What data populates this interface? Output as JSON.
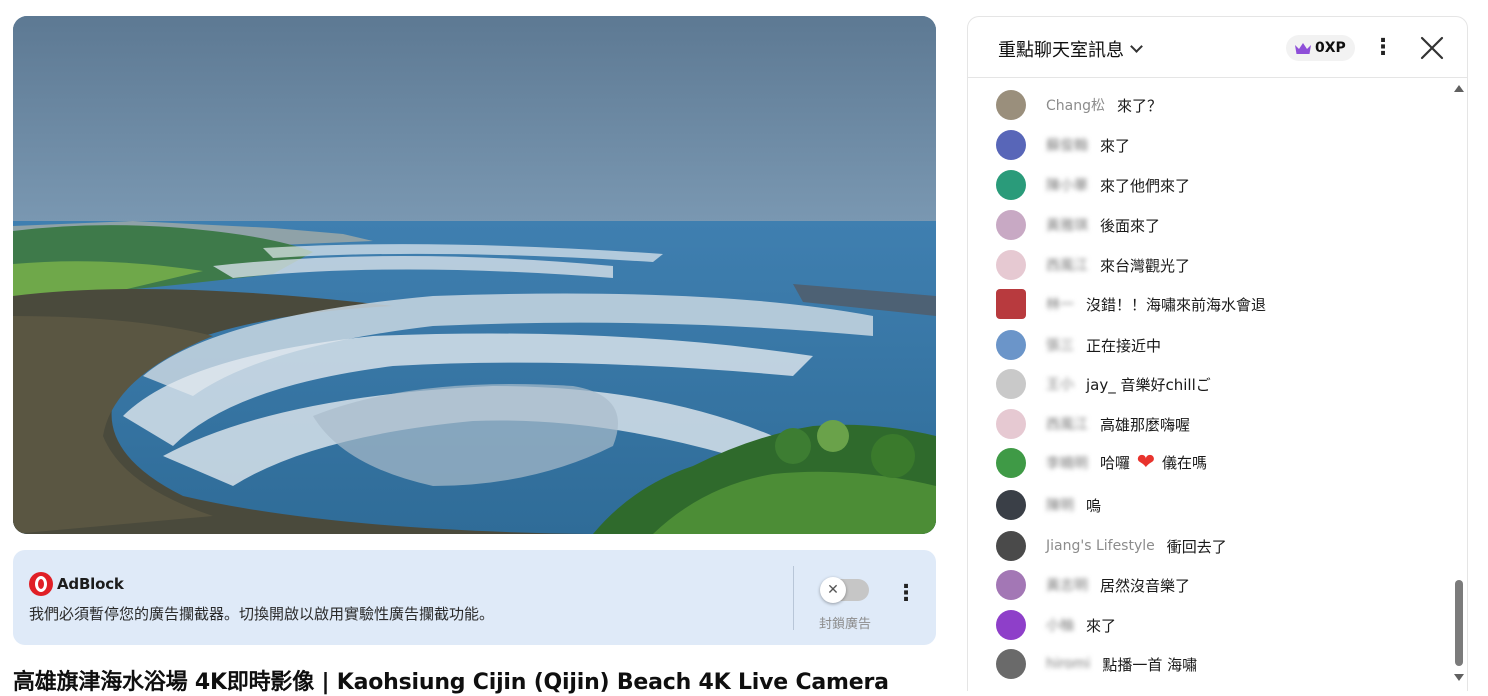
{
  "video": {
    "alt": "Kaohsiung Cijin beach live camera scene"
  },
  "adblock": {
    "brand": "AdBlock",
    "message": "我們必須暫停您的廣告攔截器。切換開啟以啟用實驗性廣告攔截功能。",
    "toggle_label": "封鎖廣告",
    "toggle_on": false
  },
  "title": "高雄旗津海水浴場 4K即時影像 | Kaohsiung Cijin (Qijin) Beach 4K Live Camera",
  "chat": {
    "mode_label": "重點聊天室訊息",
    "xp_label": "0XP",
    "messages": [
      {
        "author": "Chang松",
        "text": "來了？",
        "blurred": false,
        "avatar_color": "#9a8f7c"
      },
      {
        "author": "蘇俊翰",
        "text": "來了",
        "blurred": true,
        "avatar_color": "#5866b8"
      },
      {
        "author": "陳小華",
        "text": "來了他們來了",
        "blurred": true,
        "avatar_color": "#2a9b7a"
      },
      {
        "author": "黃雅琪",
        "text": "後面來了",
        "blurred": true,
        "avatar_color": "#c8a9c4"
      },
      {
        "author": "西風江",
        "text": "來台灣觀光了",
        "blurred": true,
        "avatar_color": "#e6c9d2"
      },
      {
        "author": "林一",
        "text": "沒錯！！海嘯來前海水會退",
        "blurred": true,
        "avatar_color": "#b83a3e"
      },
      {
        "author": "張三",
        "text": "正在接近中",
        "blurred": true,
        "avatar_color": "#6b95c9"
      },
      {
        "author": "王小",
        "text": "jay_ 音樂好chillご",
        "blurred": true,
        "avatar_color": "#c9c9c9"
      },
      {
        "author": "西風江",
        "text": "高雄那麼嗨喔",
        "blurred": true,
        "avatar_color": "#e6c9d2"
      },
      {
        "author": "李曉明",
        "text": "哈囉 ♥ 儀在嗎",
        "blurred": true,
        "avatar_color": "#3f9a46"
      },
      {
        "author": "陳明",
        "text": "嗚",
        "blurred": true,
        "avatar_color": "#3a3f47"
      },
      {
        "author": "Jiang's Lifestyle",
        "text": "衝回去了",
        "blurred": false,
        "avatar_color": "#4a4a4a"
      },
      {
        "author": "黃志明",
        "text": "居然沒音樂了",
        "blurred": true,
        "avatar_color": "#a377b5"
      },
      {
        "author": "小柚",
        "text": "來了",
        "blurred": true,
        "avatar_color": "#8e3fc9"
      },
      {
        "author": "hiromi",
        "text": "點播一首 海嘯",
        "blurred": true,
        "avatar_color": "#6a6a6a"
      }
    ]
  },
  "colors": {
    "adblock_bg": "#dfeaf8",
    "accent_red": "#e01f26",
    "heart": "#e8332d",
    "crown": "#8e4fd8"
  }
}
